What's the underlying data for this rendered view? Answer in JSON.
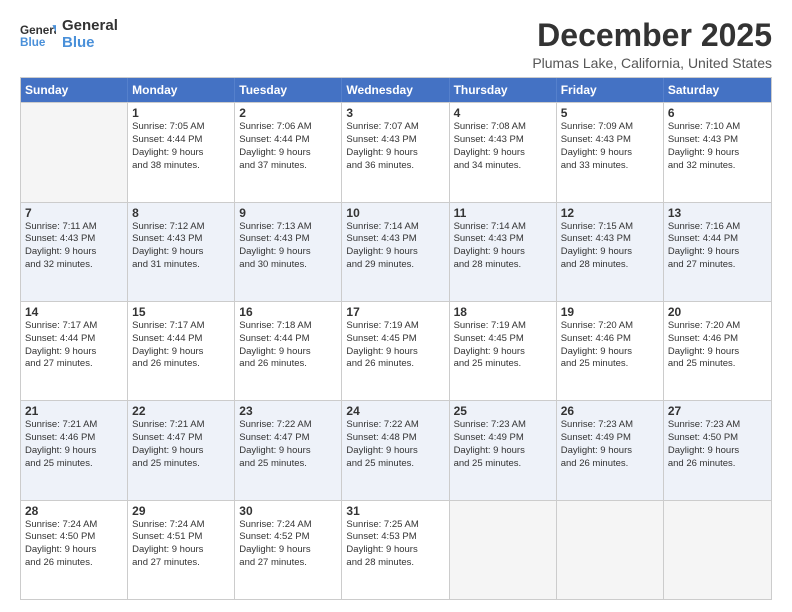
{
  "header": {
    "logo_general": "General",
    "logo_blue": "Blue",
    "month_title": "December 2025",
    "location": "Plumas Lake, California, United States"
  },
  "weekdays": [
    "Sunday",
    "Monday",
    "Tuesday",
    "Wednesday",
    "Thursday",
    "Friday",
    "Saturday"
  ],
  "rows": [
    {
      "alt": false,
      "cells": [
        {
          "day": "",
          "sunrise": "",
          "sunset": "",
          "daylight": "",
          "empty": true
        },
        {
          "day": "1",
          "sunrise": "Sunrise: 7:05 AM",
          "sunset": "Sunset: 4:44 PM",
          "daylight": "Daylight: 9 hours",
          "minutes": "and 38 minutes."
        },
        {
          "day": "2",
          "sunrise": "Sunrise: 7:06 AM",
          "sunset": "Sunset: 4:44 PM",
          "daylight": "Daylight: 9 hours",
          "minutes": "and 37 minutes."
        },
        {
          "day": "3",
          "sunrise": "Sunrise: 7:07 AM",
          "sunset": "Sunset: 4:43 PM",
          "daylight": "Daylight: 9 hours",
          "minutes": "and 36 minutes."
        },
        {
          "day": "4",
          "sunrise": "Sunrise: 7:08 AM",
          "sunset": "Sunset: 4:43 PM",
          "daylight": "Daylight: 9 hours",
          "minutes": "and 34 minutes."
        },
        {
          "day": "5",
          "sunrise": "Sunrise: 7:09 AM",
          "sunset": "Sunset: 4:43 PM",
          "daylight": "Daylight: 9 hours",
          "minutes": "and 33 minutes."
        },
        {
          "day": "6",
          "sunrise": "Sunrise: 7:10 AM",
          "sunset": "Sunset: 4:43 PM",
          "daylight": "Daylight: 9 hours",
          "minutes": "and 32 minutes."
        }
      ]
    },
    {
      "alt": true,
      "cells": [
        {
          "day": "7",
          "sunrise": "Sunrise: 7:11 AM",
          "sunset": "Sunset: 4:43 PM",
          "daylight": "Daylight: 9 hours",
          "minutes": "and 32 minutes."
        },
        {
          "day": "8",
          "sunrise": "Sunrise: 7:12 AM",
          "sunset": "Sunset: 4:43 PM",
          "daylight": "Daylight: 9 hours",
          "minutes": "and 31 minutes."
        },
        {
          "day": "9",
          "sunrise": "Sunrise: 7:13 AM",
          "sunset": "Sunset: 4:43 PM",
          "daylight": "Daylight: 9 hours",
          "minutes": "and 30 minutes."
        },
        {
          "day": "10",
          "sunrise": "Sunrise: 7:14 AM",
          "sunset": "Sunset: 4:43 PM",
          "daylight": "Daylight: 9 hours",
          "minutes": "and 29 minutes."
        },
        {
          "day": "11",
          "sunrise": "Sunrise: 7:14 AM",
          "sunset": "Sunset: 4:43 PM",
          "daylight": "Daylight: 9 hours",
          "minutes": "and 28 minutes."
        },
        {
          "day": "12",
          "sunrise": "Sunrise: 7:15 AM",
          "sunset": "Sunset: 4:43 PM",
          "daylight": "Daylight: 9 hours",
          "minutes": "and 28 minutes."
        },
        {
          "day": "13",
          "sunrise": "Sunrise: 7:16 AM",
          "sunset": "Sunset: 4:44 PM",
          "daylight": "Daylight: 9 hours",
          "minutes": "and 27 minutes."
        }
      ]
    },
    {
      "alt": false,
      "cells": [
        {
          "day": "14",
          "sunrise": "Sunrise: 7:17 AM",
          "sunset": "Sunset: 4:44 PM",
          "daylight": "Daylight: 9 hours",
          "minutes": "and 27 minutes."
        },
        {
          "day": "15",
          "sunrise": "Sunrise: 7:17 AM",
          "sunset": "Sunset: 4:44 PM",
          "daylight": "Daylight: 9 hours",
          "minutes": "and 26 minutes."
        },
        {
          "day": "16",
          "sunrise": "Sunrise: 7:18 AM",
          "sunset": "Sunset: 4:44 PM",
          "daylight": "Daylight: 9 hours",
          "minutes": "and 26 minutes."
        },
        {
          "day": "17",
          "sunrise": "Sunrise: 7:19 AM",
          "sunset": "Sunset: 4:45 PM",
          "daylight": "Daylight: 9 hours",
          "minutes": "and 26 minutes."
        },
        {
          "day": "18",
          "sunrise": "Sunrise: 7:19 AM",
          "sunset": "Sunset: 4:45 PM",
          "daylight": "Daylight: 9 hours",
          "minutes": "and 25 minutes."
        },
        {
          "day": "19",
          "sunrise": "Sunrise: 7:20 AM",
          "sunset": "Sunset: 4:46 PM",
          "daylight": "Daylight: 9 hours",
          "minutes": "and 25 minutes."
        },
        {
          "day": "20",
          "sunrise": "Sunrise: 7:20 AM",
          "sunset": "Sunset: 4:46 PM",
          "daylight": "Daylight: 9 hours",
          "minutes": "and 25 minutes."
        }
      ]
    },
    {
      "alt": true,
      "cells": [
        {
          "day": "21",
          "sunrise": "Sunrise: 7:21 AM",
          "sunset": "Sunset: 4:46 PM",
          "daylight": "Daylight: 9 hours",
          "minutes": "and 25 minutes."
        },
        {
          "day": "22",
          "sunrise": "Sunrise: 7:21 AM",
          "sunset": "Sunset: 4:47 PM",
          "daylight": "Daylight: 9 hours",
          "minutes": "and 25 minutes."
        },
        {
          "day": "23",
          "sunrise": "Sunrise: 7:22 AM",
          "sunset": "Sunset: 4:47 PM",
          "daylight": "Daylight: 9 hours",
          "minutes": "and 25 minutes."
        },
        {
          "day": "24",
          "sunrise": "Sunrise: 7:22 AM",
          "sunset": "Sunset: 4:48 PM",
          "daylight": "Daylight: 9 hours",
          "minutes": "and 25 minutes."
        },
        {
          "day": "25",
          "sunrise": "Sunrise: 7:23 AM",
          "sunset": "Sunset: 4:49 PM",
          "daylight": "Daylight: 9 hours",
          "minutes": "and 25 minutes."
        },
        {
          "day": "26",
          "sunrise": "Sunrise: 7:23 AM",
          "sunset": "Sunset: 4:49 PM",
          "daylight": "Daylight: 9 hours",
          "minutes": "and 26 minutes."
        },
        {
          "day": "27",
          "sunrise": "Sunrise: 7:23 AM",
          "sunset": "Sunset: 4:50 PM",
          "daylight": "Daylight: 9 hours",
          "minutes": "and 26 minutes."
        }
      ]
    },
    {
      "alt": false,
      "cells": [
        {
          "day": "28",
          "sunrise": "Sunrise: 7:24 AM",
          "sunset": "Sunset: 4:50 PM",
          "daylight": "Daylight: 9 hours",
          "minutes": "and 26 minutes."
        },
        {
          "day": "29",
          "sunrise": "Sunrise: 7:24 AM",
          "sunset": "Sunset: 4:51 PM",
          "daylight": "Daylight: 9 hours",
          "minutes": "and 27 minutes."
        },
        {
          "day": "30",
          "sunrise": "Sunrise: 7:24 AM",
          "sunset": "Sunset: 4:52 PM",
          "daylight": "Daylight: 9 hours",
          "minutes": "and 27 minutes."
        },
        {
          "day": "31",
          "sunrise": "Sunrise: 7:25 AM",
          "sunset": "Sunset: 4:53 PM",
          "daylight": "Daylight: 9 hours",
          "minutes": "and 28 minutes."
        },
        {
          "day": "",
          "sunrise": "",
          "sunset": "",
          "daylight": "",
          "empty": true
        },
        {
          "day": "",
          "sunrise": "",
          "sunset": "",
          "daylight": "",
          "empty": true
        },
        {
          "day": "",
          "sunrise": "",
          "sunset": "",
          "daylight": "",
          "empty": true
        }
      ]
    }
  ]
}
